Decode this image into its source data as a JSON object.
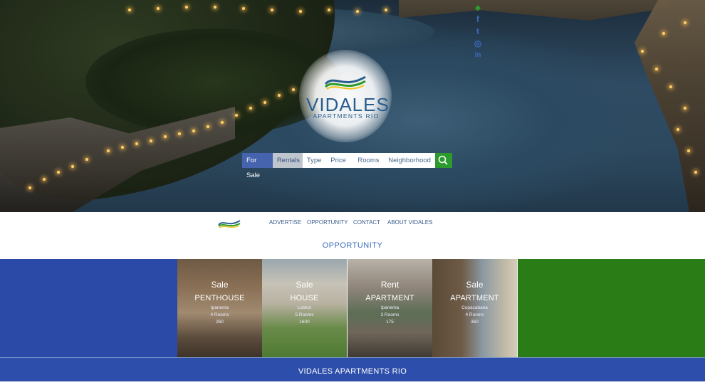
{
  "brand": {
    "title": "VIDALES",
    "subtitle": "APARTMENTS RIO",
    "colors": {
      "blue": "#2b4aa8",
      "green": "#2a7d16",
      "logo_blue": "#2a5e8e"
    }
  },
  "social": [
    {
      "icon": "facebook-icon",
      "glyph": "f"
    },
    {
      "icon": "twitter-icon",
      "glyph": "t"
    },
    {
      "icon": "instagram-icon",
      "glyph": "◎"
    },
    {
      "icon": "linkedin-icon",
      "glyph": "in"
    }
  ],
  "search": {
    "for_sale": "For Sale",
    "rentals": "Rentals",
    "type_placeholder": "Type",
    "price_placeholder": "Price",
    "rooms_placeholder": "Rooms",
    "neighborhood_placeholder": "Neighborhood",
    "go_icon": "search-icon"
  },
  "nav": {
    "items": [
      "ADVERTISE",
      "OPPORTUNITY",
      "CONTACT",
      "ABOUT VIDALES"
    ]
  },
  "section_title": "OPPORTUNITY",
  "listings": [
    {
      "kind": "Sale",
      "type": "PENTHOUSE",
      "area": "Ipanema",
      "rooms": "4 Rooms",
      "size": "260"
    },
    {
      "kind": "Sale",
      "type": "HOUSE",
      "area": "Leblon",
      "rooms": "5 Rooms",
      "size": "1600"
    },
    {
      "kind": "Rent",
      "type": "APARTMENT",
      "area": "Ipanema",
      "rooms": "3 Rooms",
      "size": "175"
    },
    {
      "kind": "Sale",
      "type": "APARTMENT",
      "area": "Copacabana",
      "rooms": "4 Rooms",
      "size": "360"
    }
  ],
  "footer": "VIDALES APARTMENTS RIO"
}
